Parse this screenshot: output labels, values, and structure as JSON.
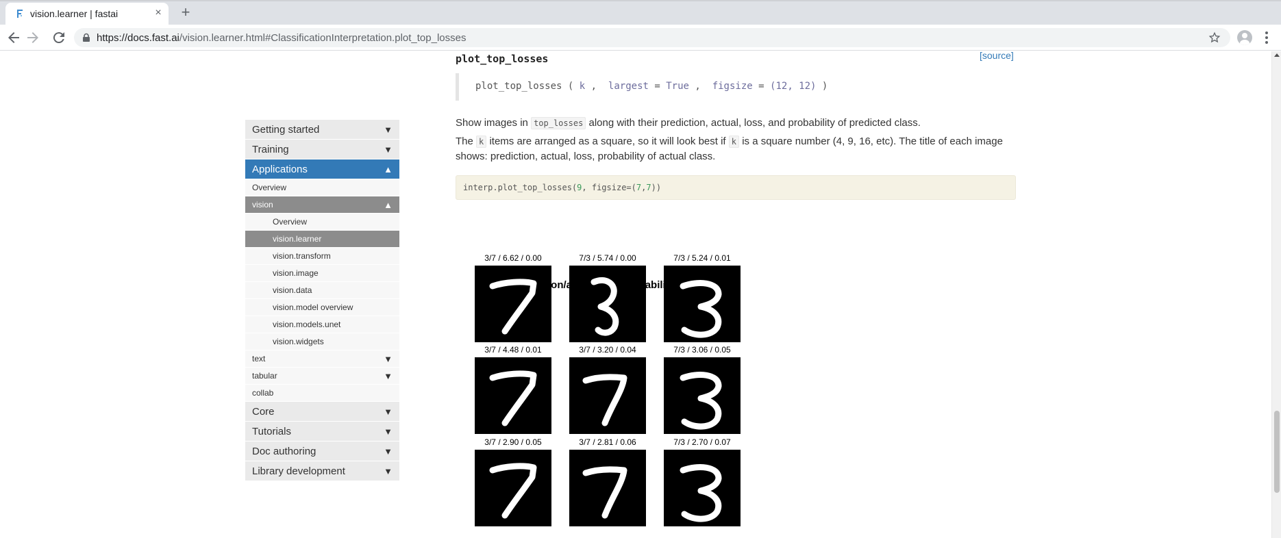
{
  "browser": {
    "tab_title": "vision.learner | fastai",
    "close_glyph": "×",
    "newtab_glyph": "+",
    "url_domain": "https://docs.fast.ai",
    "url_path": "/vision.learner.html#ClassificationInterpretation.plot_top_losses",
    "icons": [
      "favicon-icon",
      "close-icon",
      "new-tab-icon",
      "back-icon",
      "forward-icon",
      "reload-icon",
      "lock-icon",
      "star-icon",
      "avatar-icon",
      "menu-icon"
    ]
  },
  "sidebar": {
    "arrow_down": "▼",
    "arrow_up": "▲",
    "items": [
      {
        "label": "Getting started"
      },
      {
        "label": "Training"
      },
      {
        "label": "Applications"
      },
      {
        "label": "Overview"
      },
      {
        "label": "vision"
      },
      {
        "label": "Overview"
      },
      {
        "label": "vision.learner"
      },
      {
        "label": "vision.transform"
      },
      {
        "label": "vision.image"
      },
      {
        "label": "vision.data"
      },
      {
        "label": "vision.model overview"
      },
      {
        "label": "vision.models.unet"
      },
      {
        "label": "vision.widgets"
      },
      {
        "label": "text"
      },
      {
        "label": "tabular"
      },
      {
        "label": "collab"
      },
      {
        "label": "Core"
      },
      {
        "label": "Tutorials"
      },
      {
        "label": "Doc authoring"
      },
      {
        "label": "Library development"
      }
    ],
    "active_color": "#337ab7",
    "active_sub_color": "#8c8c8c"
  },
  "doc": {
    "heading": "plot_top_losses",
    "source_link": "[source]",
    "signature": {
      "name": "plot_top_losses",
      "open": "(",
      "arg1": "k",
      "comma": ",",
      "arg2_name": "largest",
      "eq": "=",
      "arg2_val": "True",
      "arg3_name": "figsize",
      "arg3_val": "(12, 12)",
      "close": ")"
    },
    "para1_before": "Show images in",
    "para1_code": "top_losses",
    "para1_after": "along with their prediction, actual, loss, and probability of predicted class.",
    "para2_a": "The",
    "para2_code1": "k",
    "para2_b": "items are arranged as a square, so it will look best if",
    "para2_code2": "k",
    "para2_c": "is a square number (4, 9, 16, etc). The title of each image shows: prediction, actual, loss, probability of actual class.",
    "code_pre": "interp.plot_top_losses(",
    "code_n1": "9",
    "code_mid": ", figsize=(",
    "code_n2": "7",
    "code_comma": ",",
    "code_n3": "7",
    "code_post": "))"
  },
  "figure": {
    "title": "prediction/actual/loss/probability",
    "cells": [
      {
        "title": "3/7 / 6.62 / 0.00",
        "digit": "7"
      },
      {
        "title": "7/3 / 5.74 / 0.00",
        "digit": "3"
      },
      {
        "title": "7/3 / 5.24 / 0.01",
        "digit": "3"
      },
      {
        "title": "3/7 / 4.48 / 0.01",
        "digit": "7"
      },
      {
        "title": "3/7 / 3.20 / 0.04",
        "digit": "7"
      },
      {
        "title": "7/3 / 3.06 / 0.05",
        "digit": "3"
      },
      {
        "title": "3/7 / 2.90 / 0.05",
        "digit": "7"
      },
      {
        "title": "3/7 / 2.81 / 0.06",
        "digit": "7"
      },
      {
        "title": "7/3 / 2.70 / 0.07",
        "digit": "3"
      }
    ]
  }
}
